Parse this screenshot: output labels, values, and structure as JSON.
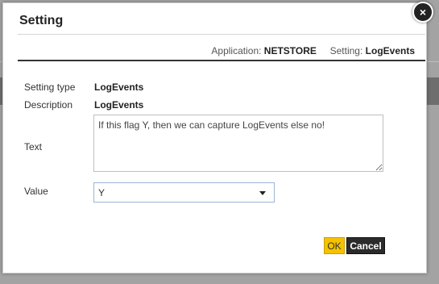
{
  "dialog": {
    "title": "Setting",
    "close_label": "×"
  },
  "context": {
    "application_label": "Application:",
    "application_value": "NETSTORE",
    "setting_label": "Setting:",
    "setting_value": "LogEvents"
  },
  "form": {
    "setting_type_label": "Setting type",
    "setting_type_value": "LogEvents",
    "description_label": "Description",
    "description_value": "LogEvents",
    "text_label": "Text",
    "text_value": "If this flag Y, then we can capture LogEvents else no!",
    "value_label": "Value",
    "value_selected": "Y"
  },
  "buttons": {
    "ok_label": "OK",
    "cancel_label": "Cancel"
  },
  "colors": {
    "ok_button": "#f5c200",
    "cancel_button": "#2b2b2b",
    "overlay": "#a3a3a3"
  }
}
